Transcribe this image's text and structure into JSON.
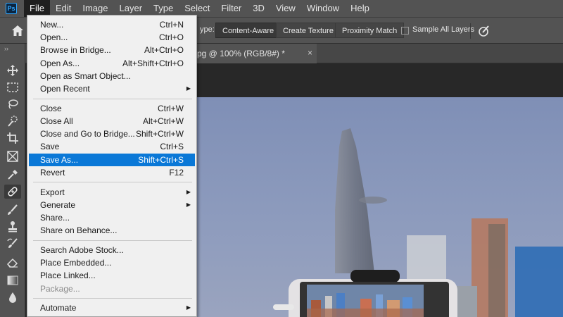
{
  "app": {
    "logo_text": "Ps"
  },
  "menubar": {
    "items": [
      "File",
      "Edit",
      "Image",
      "Layer",
      "Type",
      "Select",
      "Filter",
      "3D",
      "View",
      "Window",
      "Help"
    ]
  },
  "options": {
    "type_label": "ype:",
    "buttons": [
      "Content-Aware",
      "Create Texture",
      "Proximity Match"
    ],
    "sample_all_layers": "Sample All Layers"
  },
  "document_tab": {
    "title": "pg @ 100% (RGB/8#) *",
    "close": "×"
  },
  "file_menu": {
    "groups": [
      [
        {
          "label": "New...",
          "shortcut": "Ctrl+N"
        },
        {
          "label": "Open...",
          "shortcut": "Ctrl+O"
        },
        {
          "label": "Browse in Bridge...",
          "shortcut": "Alt+Ctrl+O"
        },
        {
          "label": "Open As...",
          "shortcut": "Alt+Shift+Ctrl+O"
        },
        {
          "label": "Open as Smart Object...",
          "shortcut": ""
        },
        {
          "label": "Open Recent",
          "shortcut": "",
          "submenu": true
        }
      ],
      [
        {
          "label": "Close",
          "shortcut": "Ctrl+W"
        },
        {
          "label": "Close All",
          "shortcut": "Alt+Ctrl+W"
        },
        {
          "label": "Close and Go to Bridge...",
          "shortcut": "Shift+Ctrl+W"
        },
        {
          "label": "Save",
          "shortcut": "Ctrl+S"
        },
        {
          "label": "Save As...",
          "shortcut": "Shift+Ctrl+S",
          "highlighted": true
        },
        {
          "label": "Revert",
          "shortcut": "F12"
        }
      ],
      [
        {
          "label": "Export",
          "shortcut": "",
          "submenu": true
        },
        {
          "label": "Generate",
          "shortcut": "",
          "submenu": true
        },
        {
          "label": "Share...",
          "shortcut": ""
        },
        {
          "label": "Share on Behance...",
          "shortcut": ""
        }
      ],
      [
        {
          "label": "Search Adobe Stock...",
          "shortcut": ""
        },
        {
          "label": "Place Embedded...",
          "shortcut": ""
        },
        {
          "label": "Place Linked...",
          "shortcut": ""
        },
        {
          "label": "Package...",
          "shortcut": "",
          "disabled": true
        }
      ],
      [
        {
          "label": "Automate",
          "shortcut": "",
          "submenu": true
        }
      ]
    ]
  },
  "tools": [
    "move-icon",
    "marquee-icon",
    "lasso-icon",
    "quick-select-icon",
    "crop-icon",
    "frame-icon",
    "eyedropper-icon",
    "healing-brush-icon",
    "brush-icon",
    "clone-stamp-icon",
    "history-brush-icon",
    "eraser-icon",
    "gradient-icon",
    "blur-icon"
  ],
  "colors": {
    "menu_highlight": "#0a78d7",
    "panel_bg": "#535353",
    "sky": "#8a99bd"
  }
}
